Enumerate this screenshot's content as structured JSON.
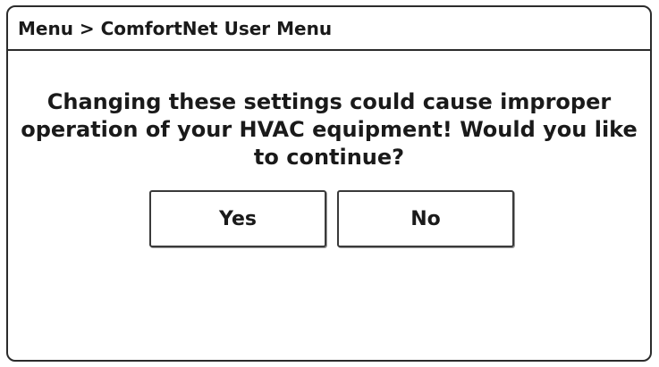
{
  "header": {
    "breadcrumb": "Menu > ComfortNet User Menu"
  },
  "dialog": {
    "message": "Changing these settings could cause improper operation of your HVAC equipment! Would you like to continue?",
    "yes_label": "Yes",
    "no_label": "No"
  }
}
